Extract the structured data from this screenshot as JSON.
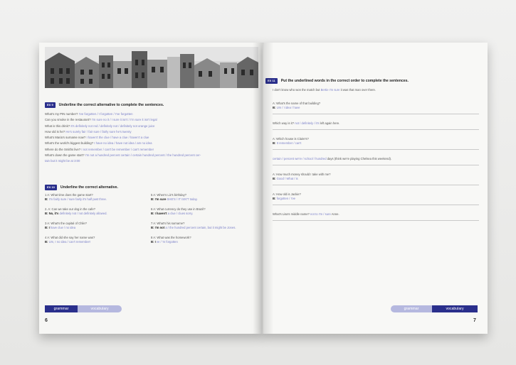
{
  "left_page": {
    "ex9": {
      "badge": "EX 9",
      "instruction": "Underline the correct alternative to complete the sentences.",
      "lines": [
        {
          "q": "What's my PIN number? ",
          "a": "I've forgotten / I forgotten / I've forgotten"
        },
        {
          "q": "Can you smoke in the restaurant? ",
          "a": "I'm sure no it / I sure it isn't / I'm sure it isn't legal"
        },
        {
          "q": "What is this drink? ",
          "a": "It's definitely not red / definitely not / definitely not orange juice"
        },
        {
          "q": "How old is he? ",
          "a": "He's surely fair / fair sure / fairly sure he's twenty"
        },
        {
          "q": "What's Maria's surname now? ",
          "a": "I haven't the clue / have a clue / haven't a clue"
        },
        {
          "q": "What's the world's biggest building? ",
          "a": "I have no idea / have not idea / am no idea"
        },
        {
          "q": "Where do the Smiths live? ",
          "a": "I not remember / can't be remember / can't remember"
        },
        {
          "q": "What's down the game start? ",
          "a": "I'm not a hundred percent certain / certain hundred percent / the hundred percent cer-"
        },
        {
          "q": "",
          "a": "tain but it might be at 3:00"
        }
      ]
    },
    "ex10": {
      "badge": "EX 10",
      "instruction": "Underline the correct alternative.",
      "col1": [
        {
          "q": "1 A: What time does the game start?",
          "b": "B: ",
          "a": "I'm fairly sure / sure fairly it's half past three."
        },
        {
          "q": "2. A: Can we take our dog in the cafe?",
          "b": "B: No, it's ",
          "a": "definitely not / not definitely allowed."
        },
        {
          "q": "3 A: What's the capital of Chile?",
          "b": "B: I ",
          "a": "have clue / no idea"
        },
        {
          "q": "4 A: What did she say her name was?",
          "b": "B: ",
          "a": "Um, I no idea / can't remember!"
        }
      ],
      "col2": [
        {
          "q": "5 A: When's Liz's birthday?",
          "b": "B: I'm sure ",
          "a": "SHE'S / IT ISN'T today."
        },
        {
          "q": "6 A: What currency do they use in Brazil?",
          "b": "B: I haven't ",
          "a": "a clue / clues sorry."
        },
        {
          "q": "7 A: What's his surname?",
          "b": "B: I'm not ",
          "a": "a / the hundred percent certain, but it might be Jones."
        },
        {
          "q": "8 A: What was the homework?",
          "b": "B: I ",
          "a": "ve / 'm forgotten"
        }
      ]
    },
    "tabs": {
      "grammar": "grammar",
      "vocabulary": "vocabulary"
    },
    "page_number": "6"
  },
  "right_page": {
    "ex11": {
      "badge": "EX 11",
      "instruction": "Put the underlined words in the correct order to complete the sentences."
    },
    "intro": {
      "text": "I don't know who won the match but ",
      "ans": "Bertie I'm sure",
      "tail": " it was that man over there."
    },
    "items": [
      {
        "q": "A: What's the name of that building?",
        "b": "B: ",
        "a": "Um / I idea / have"
      },
      {
        "q": "Which way is it? ",
        "a": "not / definitely / it's",
        "tail": " left again here."
      },
      {
        "q": "A: Which house is Claire's?",
        "b": "B: ",
        "a": "It remember / can't"
      },
      {
        "q": "",
        "a": "certain / percent we're / school / hundred",
        "tail": " days (think we're playing Chelsea this weekend)."
      },
      {
        "q": "A: How much money should I take with me?",
        "b": "B: ",
        "a": "Good / What / is"
      },
      {
        "q": "A: How old is Jackie?",
        "b": "B: ",
        "a": "forgotten / I've"
      },
      {
        "q": "What's Lisa's middle name? ",
        "a": "not to I'm / sure",
        "tail": " Anne."
      }
    ],
    "tabs": {
      "grammar": "grammar",
      "vocabulary": "vocabulary"
    },
    "page_number": "7"
  },
  "colors": {
    "accent": "#2a2f8c",
    "accent_light": "#b5b8df",
    "answer": "#7b80c8"
  }
}
